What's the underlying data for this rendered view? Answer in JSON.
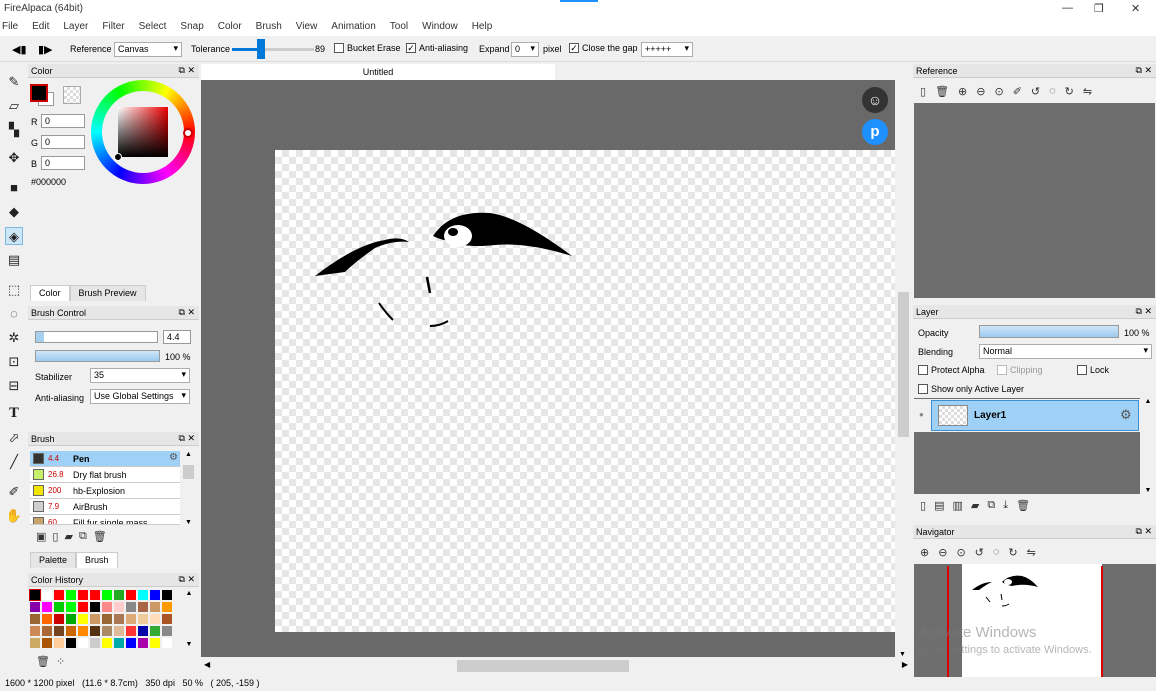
{
  "app": {
    "title": "FireAlpaca (64bit)"
  },
  "menu": [
    "File",
    "Edit",
    "Layer",
    "Filter",
    "Select",
    "Snap",
    "Color",
    "Brush",
    "View",
    "Animation",
    "Tool",
    "Window",
    "Help"
  ],
  "toolbar": {
    "reference_label": "Reference",
    "reference_value": "Canvas",
    "tolerance_label": "Tolerance",
    "tolerance_value": "89",
    "tolerance_level": 0.89,
    "bucket_erase": "Bucket Erase",
    "anti_aliasing": "Anti-aliasing",
    "expand_label": "Expand",
    "expand_value": "0",
    "pixel_label": "pixel",
    "close_gap": "Close the gap",
    "gap_value": "+++++"
  },
  "color_panel": {
    "title": "Color",
    "r_label": "R",
    "r_value": "0",
    "g_label": "G",
    "g_value": "0",
    "b_label": "B",
    "b_value": "0",
    "hex": "#000000",
    "tab_color": "Color",
    "tab_brush_preview": "Brush Preview",
    "current_color": "#000000"
  },
  "brush_control": {
    "title": "Brush Control",
    "size": "4.4",
    "opacity": "100 %",
    "stabilizer_label": "Stabilizer",
    "stabilizer_value": "35",
    "aa_label": "Anti-aliasing",
    "aa_value": "Use Global Settings"
  },
  "brush_panel": {
    "title": "Brush",
    "items": [
      {
        "size": "4.4",
        "name": "Pen",
        "color": "#333333"
      },
      {
        "size": "26.8",
        "name": "Dry flat brush",
        "color": "#c6f06a"
      },
      {
        "size": "200",
        "name": "hb-Explosion",
        "color": "#f2e600"
      },
      {
        "size": "7.9",
        "name": "AirBrush",
        "color": "#cfcfcf"
      },
      {
        "size": "60",
        "name": "Fill fur single mass",
        "color": "#c9a46a"
      }
    ],
    "tab_palette": "Palette",
    "tab_brush": "Brush"
  },
  "color_history": {
    "title": "Color History",
    "colors": [
      "#000000",
      "#ffffff",
      "#ff0000",
      "#00ff00",
      "#ff0000",
      "#ff0000",
      "#00ff00",
      "#22aa22",
      "#ff0000",
      "#00ffff",
      "#0000ff",
      "#000000",
      "#8800aa",
      "#ff00ff",
      "#00cc00",
      "#00ff00",
      "#ff0000",
      "#000000",
      "#ff8888",
      "#ffcccc",
      "#888888",
      "#aa6644",
      "#cc9966",
      "#ff9900",
      "#996633",
      "#ff6600",
      "#cc0000",
      "#00aa00",
      "#ffff00",
      "#cc9966",
      "#996633",
      "#aa7755",
      "#ddaa77",
      "#eecc99",
      "#ffddbb",
      "#aa5522",
      "#cc8855",
      "#aa6633",
      "#774422",
      "#cc6600",
      "#ff8800",
      "#553311",
      "#aa8866",
      "#ddbb99",
      "#ff3333",
      "#0000aa",
      "#33aa33",
      "#888888",
      "#ccaa66",
      "#aa5500",
      "#ffcc99",
      "#000000",
      "#ffffff",
      "#cccccc",
      "#ffff00",
      "#00aaaa",
      "#0000ff",
      "#aa00aa",
      "#ffff00",
      "#ffffff",
      "#cccccc"
    ]
  },
  "canvas": {
    "tab": "Untitled"
  },
  "reference_panel": {
    "title": "Reference"
  },
  "layer_panel": {
    "title": "Layer",
    "opacity_label": "Opacity",
    "opacity_value": "100 %",
    "blending_label": "Blending",
    "blending_value": "Normal",
    "protect_alpha": "Protect Alpha",
    "clipping": "Clipping",
    "lock": "Lock",
    "show_active": "Show only Active Layer",
    "layer_name": "Layer1"
  },
  "navigator": {
    "title": "Navigator"
  },
  "watermark": {
    "line1": "Activate Windows",
    "line2": "Go to Settings to activate Windows."
  },
  "status": {
    "text": "1600 * 1200 pixel   (11.6 * 8.7cm)   350 dpi   50 %   ( 205, -159 )"
  }
}
